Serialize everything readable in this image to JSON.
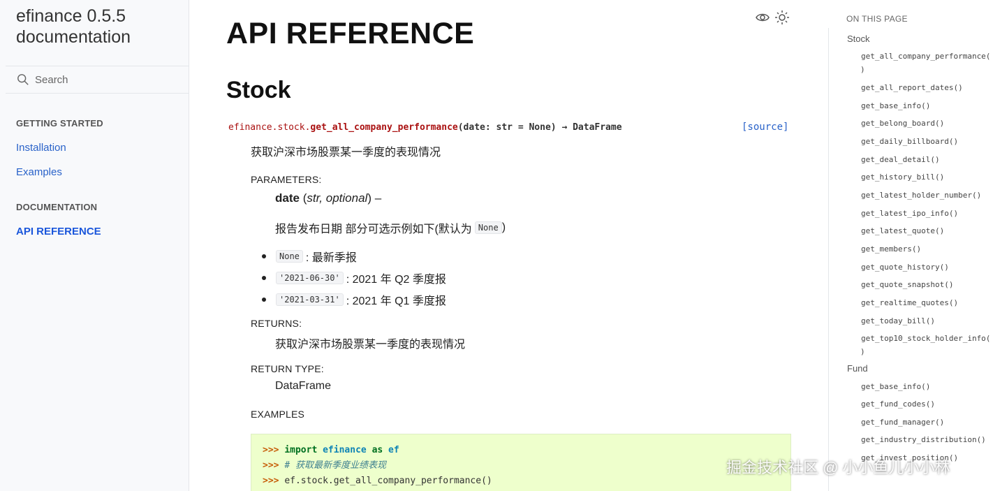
{
  "sidebar": {
    "brand": "efinance 0.5.5 documentation",
    "search_placeholder": "Search",
    "sections": [
      {
        "caption": "GETTING STARTED",
        "links": [
          "Installation",
          "Examples"
        ]
      },
      {
        "caption": "DOCUMENTATION",
        "links": [
          "API REFERENCE"
        ]
      }
    ]
  },
  "main": {
    "title": "API REFERENCE",
    "section_title": "Stock",
    "signature": {
      "module": "efinance.stock.",
      "function": "get_all_company_performance",
      "params": "(date: str = None) → DataFrame",
      "source_label": "[source]"
    },
    "description": "获取沪深市场股票某一季度的表现情况",
    "parameters_label": "PARAMETERS:",
    "param_name": "date",
    "param_type": "str, optional",
    "param_suffix": ") –",
    "param_desc": "报告发布日期 部分可选示例如下(默认为",
    "param_default": "None",
    "param_desc_end": ")",
    "options": [
      {
        "code": "None",
        "text": ": 最新季报"
      },
      {
        "code": "'2021-06-30'",
        "text": ": 2021 年 Q2 季度报"
      },
      {
        "code": "'2021-03-31'",
        "text": ": 2021 年 Q1 季度报"
      }
    ],
    "returns_label": "RETURNS:",
    "returns_text": "获取沪深市场股票某一季度的表现情况",
    "return_type_label": "RETURN TYPE:",
    "return_type": "DataFrame",
    "examples_label": "EXAMPLES",
    "code": {
      "prompt": ">>>",
      "line1_kw": "import",
      "line1_mod": "efinance",
      "line1_as": "as",
      "line1_alias": "ef",
      "line2_comment": "# 获取最新季度业绩表现",
      "line3": "ef.stock.get_all_company_performance()"
    }
  },
  "toc": {
    "title": "ON THIS PAGE",
    "groups": [
      {
        "name": "Stock",
        "items": [
          "get_all_company_performance(",
          "get_all_report_dates()",
          "get_base_info()",
          "get_belong_board()",
          "get_daily_billboard()",
          "get_deal_detail()",
          "get_history_bill()",
          "get_latest_holder_number()",
          "get_latest_ipo_info()",
          "get_latest_quote()",
          "get_members()",
          "get_quote_history()",
          "get_quote_snapshot()",
          "get_realtime_quotes()",
          "get_today_bill()",
          "get_top10_stock_holder_info("
        ]
      },
      {
        "name": "Fund",
        "items": [
          "get_base_info()",
          "get_fund_codes()",
          "get_fund_manager()",
          "get_industry_distribution()",
          "get_invest_position()"
        ]
      }
    ],
    "paren": ")"
  },
  "watermark": "掘金技术社区 @ 小小鱼儿小小林"
}
